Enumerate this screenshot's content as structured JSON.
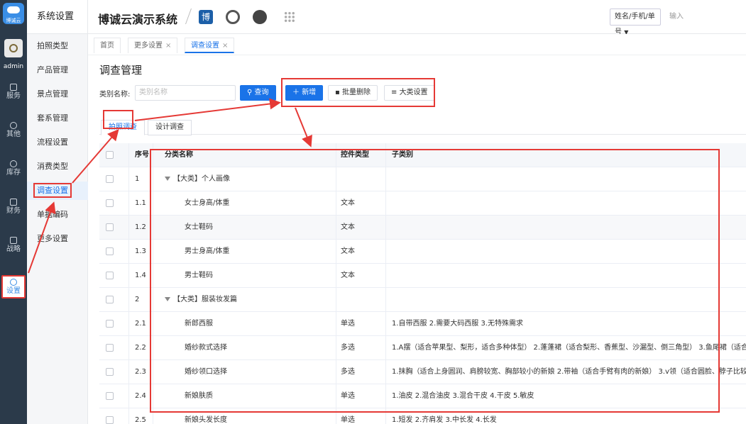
{
  "rail": {
    "logo_text": "博诚云",
    "user": "admin",
    "items": [
      {
        "label": "服务",
        "icon": "grid-icon"
      },
      {
        "label": "其他",
        "icon": "clock-icon"
      },
      {
        "label": "库存",
        "icon": "box-icon"
      },
      {
        "label": "财务",
        "icon": "wallet-icon"
      },
      {
        "label": "战略",
        "icon": "strategy-icon"
      },
      {
        "label": "设置",
        "icon": "gear-icon"
      }
    ]
  },
  "sidebar": {
    "title": "系统设置",
    "items": [
      "拍照类型",
      "产品管理",
      "景点管理",
      "套系管理",
      "流程设置",
      "消费类型",
      "调查设置",
      "单据编码",
      "更多设置"
    ]
  },
  "header": {
    "system_name": "博诚云演示系统",
    "search_select": "姓名/手机/单号",
    "search_placeholder": "输入"
  },
  "tabs": [
    {
      "label": "首页",
      "closable": false
    },
    {
      "label": "更多设置",
      "closable": true
    },
    {
      "label": "调查设置",
      "closable": true
    }
  ],
  "page": {
    "title": "调查管理",
    "filter_label": "类别名称:",
    "filter_placeholder": "类别名称",
    "buttons": {
      "query": "查询",
      "add": "新增",
      "batch_delete": "批量删除",
      "category_settings": "大类设置"
    },
    "sub_tabs": [
      "拍照调查",
      "设计调查"
    ]
  },
  "table": {
    "columns": [
      "序号",
      "分类名称",
      "控件类型",
      "子类别"
    ],
    "rows": [
      {
        "no": "1",
        "name": "【大类】个人画像",
        "type": "",
        "sub": "",
        "group": true
      },
      {
        "no": "1.1",
        "name": "女士身高/体重",
        "type": "文本",
        "sub": ""
      },
      {
        "no": "1.2",
        "name": "女士鞋码",
        "type": "文本",
        "sub": ""
      },
      {
        "no": "1.3",
        "name": "男士身高/体重",
        "type": "文本",
        "sub": ""
      },
      {
        "no": "1.4",
        "name": "男士鞋码",
        "type": "文本",
        "sub": ""
      },
      {
        "no": "2",
        "name": "【大类】服装妆发篇",
        "type": "",
        "sub": "",
        "group": true
      },
      {
        "no": "2.1",
        "name": "新郎西服",
        "type": "单选",
        "sub": "1.自带西服 2.需要大码西服 3.无特殊需求"
      },
      {
        "no": "2.2",
        "name": "婚纱款式选择",
        "type": "多选",
        "sub": "1.A摆（适合苹果型、梨形，适合多种体型） 2.蓬蓬裙（适合梨形、香蕉型、沙漏型、倒三角型） 3.鱼尾裙（适合沙"
      },
      {
        "no": "2.3",
        "name": "婚纱领口选择",
        "type": "多选",
        "sub": "1.抹胸（适合上身圆润、肩膀较宽、胸部较小的新娘 2.带袖（适合手臂有肉的新娘） 3.v领（适合圆脸、脖子比较短"
      },
      {
        "no": "2.4",
        "name": "新娘肤质",
        "type": "单选",
        "sub": "1.油皮 2.混合油皮 3.混合干皮 4.干皮 5.敏皮"
      },
      {
        "no": "2.5",
        "name": "新娘头发长度",
        "type": "单选",
        "sub": "1.短发 2.齐肩发 3.中长发 4.长发"
      }
    ]
  },
  "colors": {
    "accent": "#1a73e8",
    "rail_bg": "#2b3a4a",
    "highlight": "#e53935"
  }
}
